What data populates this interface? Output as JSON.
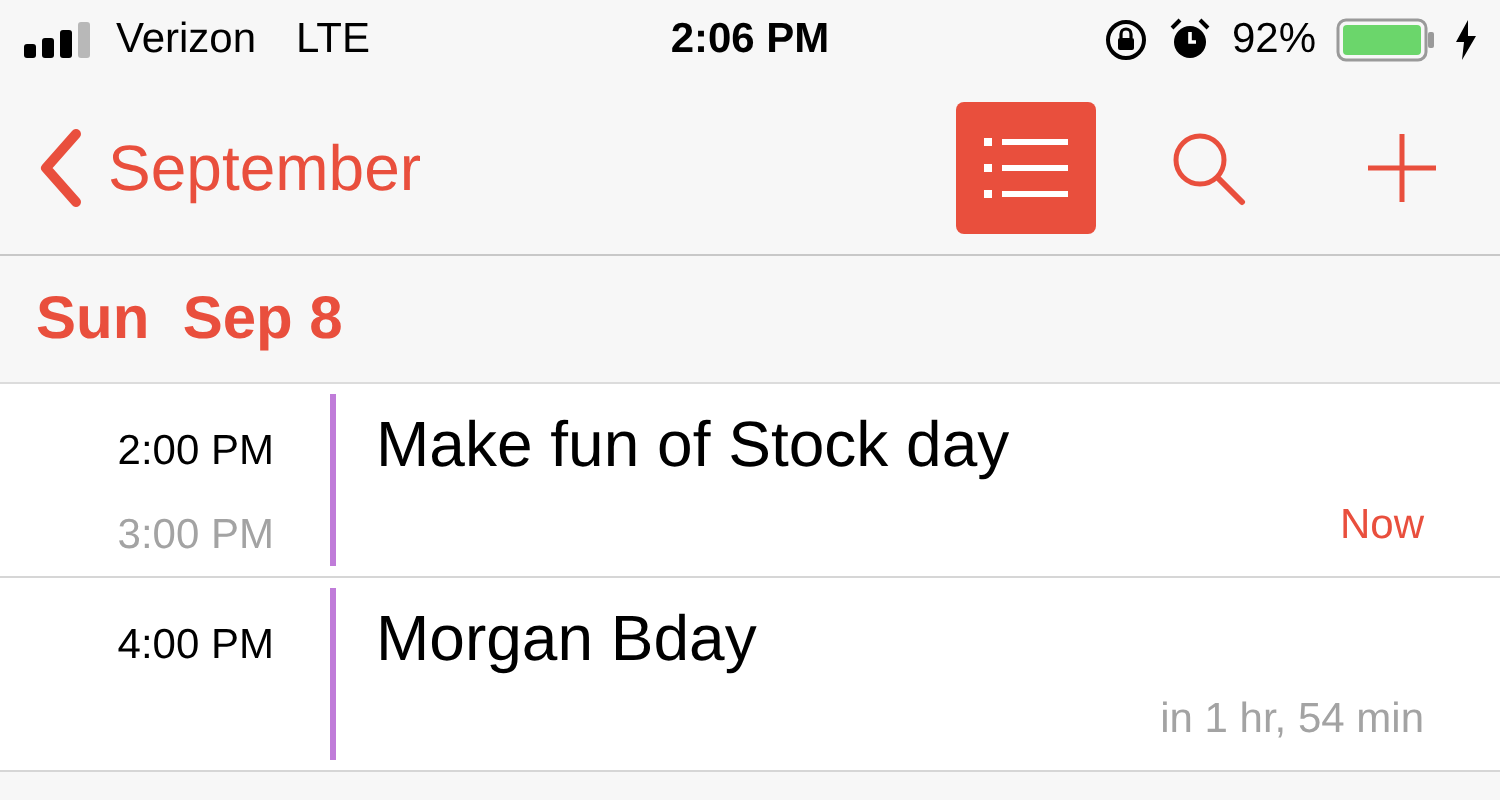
{
  "status_bar": {
    "carrier": "Verizon",
    "network": "LTE",
    "time": "2:06 PM",
    "battery": "92%"
  },
  "nav": {
    "back": "September",
    "list_view": {
      "selected": true
    }
  },
  "day_header": "Sun  Sep 8",
  "events": [
    {
      "start": "2:00 PM",
      "end": "3:00 PM",
      "title": "Make fun of Stock day",
      "note": "Now",
      "kind": "now",
      "color": "#c07cd9"
    },
    {
      "start": "4:00 PM",
      "title": "Morgan Bday",
      "note": "in 1 hr, 54 min",
      "kind": "countdown",
      "color": "#c07cd9"
    }
  ]
}
